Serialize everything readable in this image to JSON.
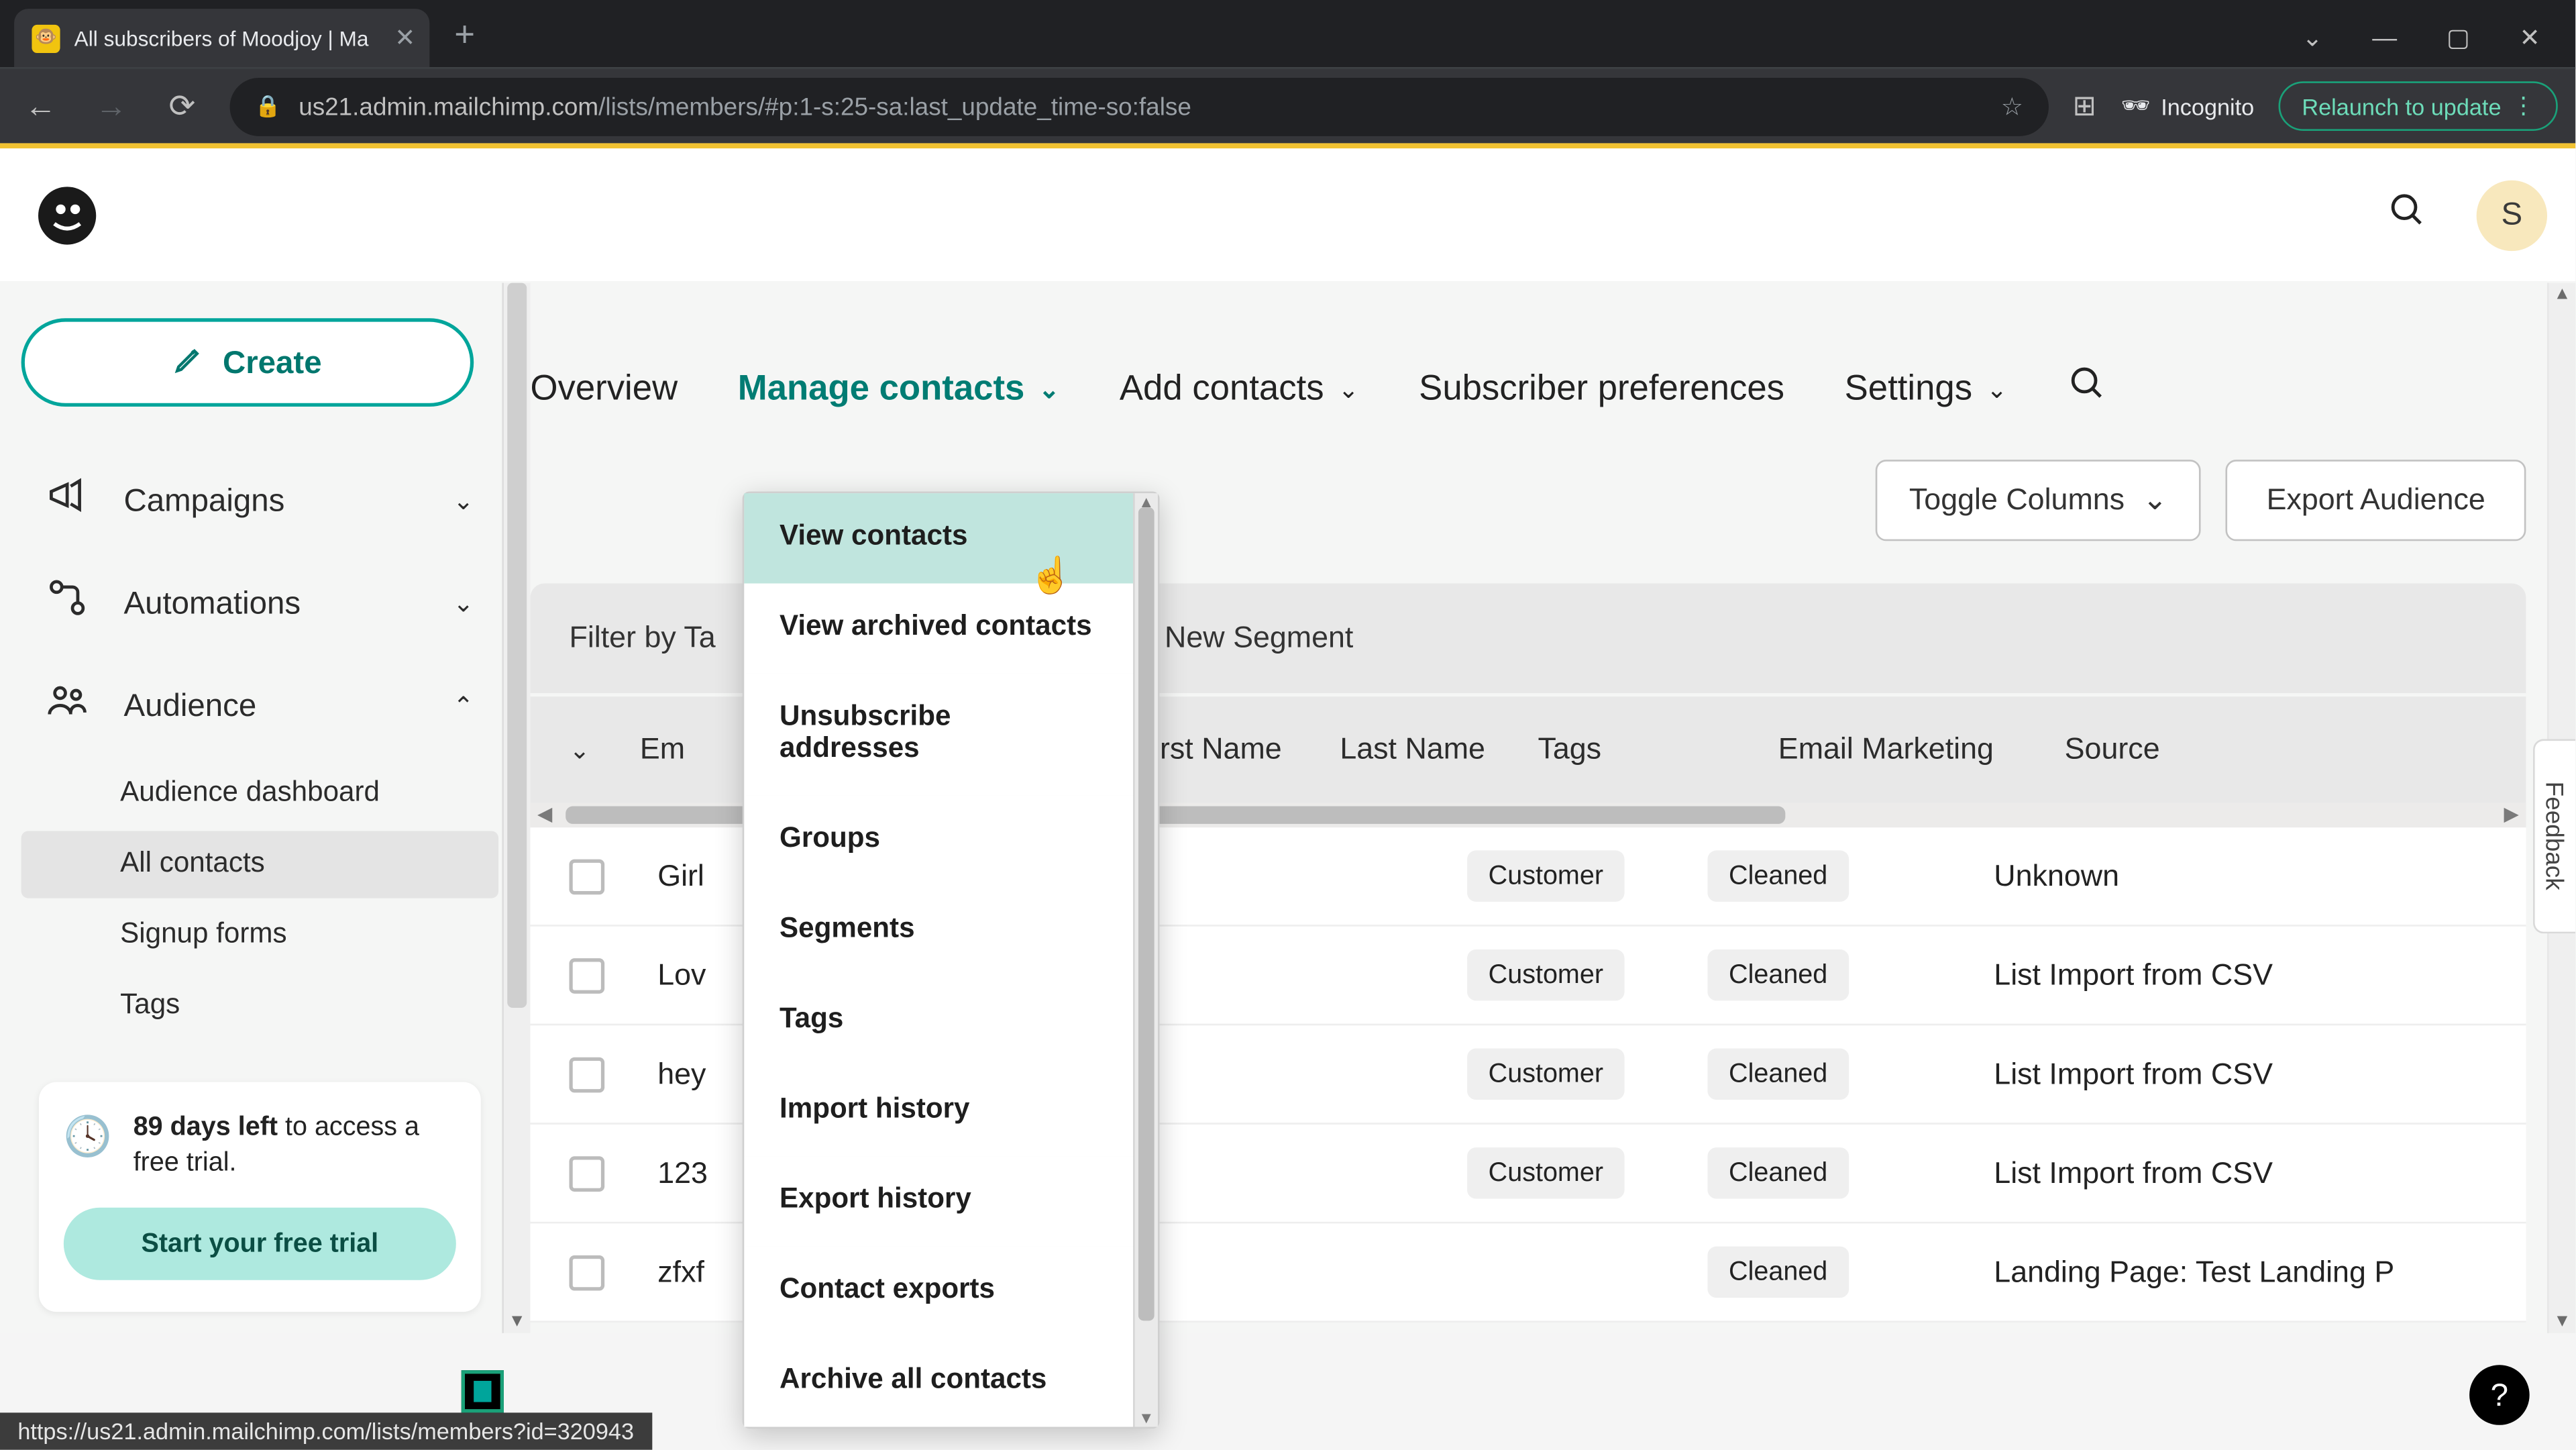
{
  "browser": {
    "tab_title": "All subscribers of Moodjoy | Ma",
    "url_host": "us21.admin.mailchimp.com",
    "url_path": "/lists/members/#p:1-s:25-sa:last_update_time-so:false",
    "incognito": "Incognito",
    "relaunch": "Relaunch to update",
    "status_url": "https://us21.admin.mailchimp.com/lists/members?id=320943"
  },
  "header": {
    "avatar_letter": "S"
  },
  "sidebar": {
    "create": "Create",
    "items": [
      {
        "label": "Campaigns"
      },
      {
        "label": "Automations"
      },
      {
        "label": "Audience"
      }
    ],
    "audience_sub": [
      {
        "label": "Audience dashboard"
      },
      {
        "label": "All contacts"
      },
      {
        "label": "Signup forms"
      },
      {
        "label": "Tags"
      }
    ],
    "trial": {
      "bold": "89 days left",
      "rest": " to access a free trial.",
      "cta": "Start your free trial"
    }
  },
  "tabs": {
    "overview": "Overview",
    "manage": "Manage contacts",
    "add": "Add contacts",
    "prefs": "Subscriber preferences",
    "settings": "Settings"
  },
  "toolbar": {
    "toggle": "Toggle Columns",
    "export": "Export Audience"
  },
  "filter": {
    "by_tags": "Filter by Ta",
    "new_segment": "New Segment"
  },
  "columns": {
    "email": "Em",
    "first": "First Name",
    "last": "Last Name",
    "tags": "Tags",
    "em": "Email Marketing",
    "src": "Source"
  },
  "rows": [
    {
      "email": "Girl",
      "tag": "Customer",
      "status": "Cleaned",
      "source": "Unknown"
    },
    {
      "email": "Lov",
      "tag": "Customer",
      "status": "Cleaned",
      "source": "List Import from CSV"
    },
    {
      "email": "hey",
      "tag": "Customer",
      "status": "Cleaned",
      "source": "List Import from CSV"
    },
    {
      "email": "123",
      "tag": "Customer",
      "status": "Cleaned",
      "source": "List Import from CSV"
    },
    {
      "email": "zfxf",
      "tag": "",
      "status": "Cleaned",
      "source": "Landing Page:   Test Landing P"
    }
  ],
  "dropdown": [
    "View contacts",
    "View archived contacts",
    "Unsubscribe addresses",
    "Groups",
    "Segments",
    "Tags",
    "Import history",
    "Export history",
    "Contact exports",
    "Archive all contacts"
  ],
  "feedback": "Feedback"
}
